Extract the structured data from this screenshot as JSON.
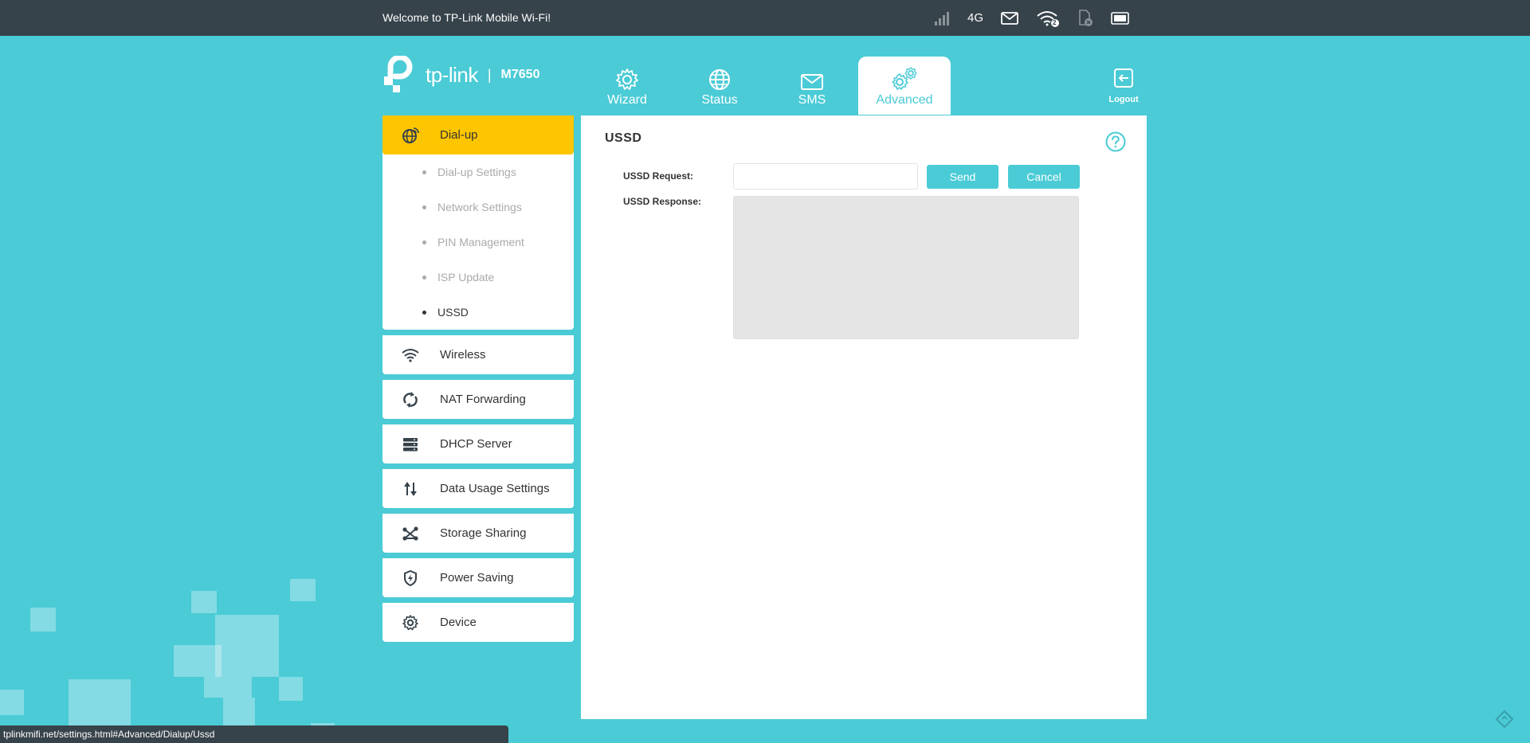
{
  "topbar": {
    "welcome": "Welcome to TP-Link Mobile Wi-Fi!",
    "network_type": "4G",
    "wifi_client_count": "2",
    "icons": [
      "signal-bars-icon",
      "mail-icon",
      "wifi-clients-icon",
      "sim-card-missing-icon",
      "battery-icon"
    ]
  },
  "header": {
    "logo_text": "tp-link",
    "separator": "|",
    "model": "M7650",
    "tabs": [
      {
        "label": "Wizard",
        "icon": "gear-icon"
      },
      {
        "label": "Status",
        "icon": "globe-icon"
      },
      {
        "label": "SMS",
        "icon": "envelope-icon"
      },
      {
        "label": "Advanced",
        "icon": "gears-icon",
        "active": true
      }
    ],
    "logout_label": "Logout"
  },
  "sidebar": {
    "groups": [
      {
        "label": "Dial-up",
        "icon": "globe-dialup-icon",
        "active": true,
        "items": [
          {
            "label": "Dial-up Settings"
          },
          {
            "label": "Network Settings"
          },
          {
            "label": "PIN Management"
          },
          {
            "label": "ISP Update"
          },
          {
            "label": "USSD",
            "current": true
          }
        ]
      },
      {
        "label": "Wireless",
        "icon": "wifi-icon"
      },
      {
        "label": "NAT Forwarding",
        "icon": "nat-forwarding-icon"
      },
      {
        "label": "DHCP Server",
        "icon": "server-icon"
      },
      {
        "label": "Data Usage Settings",
        "icon": "data-usage-arrows-icon"
      },
      {
        "label": "Storage Sharing",
        "icon": "share-icon"
      },
      {
        "label": "Power Saving",
        "icon": "shield-bolt-icon"
      },
      {
        "label": "Device",
        "icon": "gear-icon"
      }
    ]
  },
  "content": {
    "title": "USSD",
    "request_label": "USSD Request:",
    "request_value": "",
    "response_label": "USSD Response:",
    "response_value": "",
    "send_label": "Send",
    "cancel_label": "Cancel"
  },
  "statusbar": {
    "url": "tplinkmifi.net/settings.html#Advanced/Dialup/Ussd"
  },
  "colors": {
    "background": "#4acbd6",
    "topbar": "#37434b",
    "active_menu": "#fec600",
    "accent": "#4acbd6"
  }
}
